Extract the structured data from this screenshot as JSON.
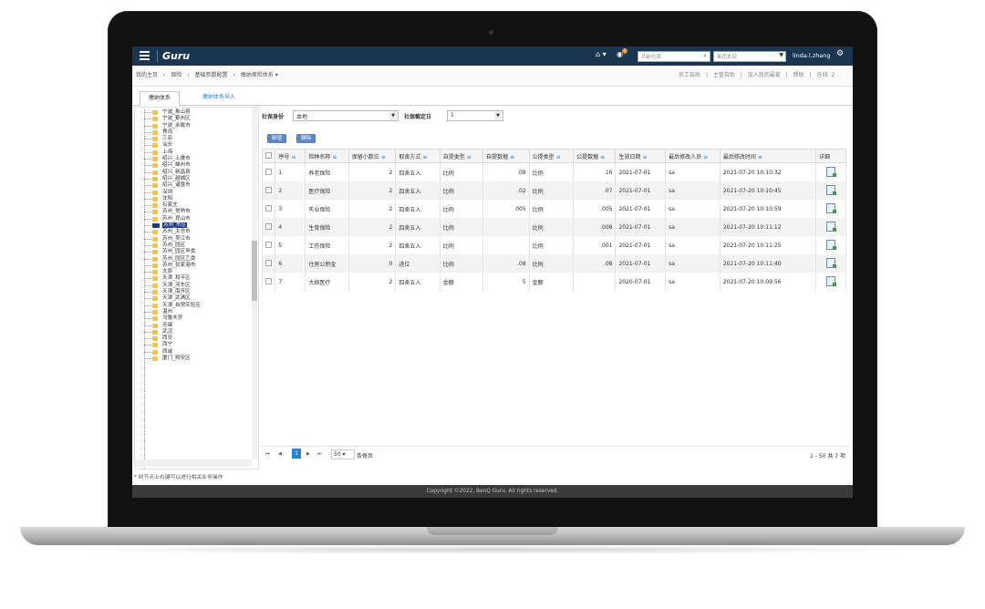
{
  "topbar": {
    "app_name": "Guru",
    "search_placeholder": "功能检索",
    "org_select_placeholder": "集团本部",
    "user_name": "linda.l.zhang",
    "notification_count": "2",
    "menu_icon": "hamburger-icon",
    "home_icon": "home-icon",
    "bell_icon": "bell-icon",
    "gear_icon": "gear-icon"
  },
  "breadcrumb": [
    "我的主页",
    "›",
    "保险",
    "›",
    "基础参数配置",
    "›",
    "缴纳保险体系 ▾"
  ],
  "toplinks": [
    "员工自助",
    "|",
    "主管自助",
    "|",
    "加入我的最爱",
    "|",
    "帮助",
    "|",
    "在线: 2"
  ],
  "tabs": [
    {
      "label": "缴纳体系",
      "active": true
    },
    {
      "label": "缴纳体系导入",
      "active": false
    }
  ],
  "tree": {
    "items": [
      "宁波_象山县",
      "宁波_鄞州区",
      "宁波_余姚市",
      "青岛",
      "三亚",
      "汕头",
      "上海",
      "绍兴_上虞市",
      "绍兴_嵊州市",
      "绍兴_新昌县",
      "绍兴_越城区",
      "绍兴_诸暨市",
      "深圳",
      "沈阳",
      "石家庄",
      "苏州_常熟市",
      "苏州_昆山市",
      "苏州_市区",
      "苏州_太仓市",
      "苏州_吴江市",
      "苏州_园区",
      "苏州_园区甲类",
      "苏州_园区乙类",
      "苏州_张家港市",
      "太原",
      "天津_和平区",
      "天津_河东区",
      "天津_南开区",
      "天津_武清区",
      "天津_自贸实验区",
      "温州",
      "乌鲁木齐",
      "无锡",
      "武汉",
      "西安",
      "西宁",
      "西咸",
      "厦门_翔安区"
    ],
    "selected": "苏州_市区",
    "note": "* 树节点上右键可以进行相关业务操作"
  },
  "filters": {
    "identity_label": "社保身份",
    "identity_value": "本地",
    "day_label": "社保截定日",
    "day_value": "1"
  },
  "buttons": {
    "add": "新增",
    "delete": "删除"
  },
  "table": {
    "columns": [
      "序号",
      "险种名称",
      "保留小数位",
      "取舍方式",
      "自提类型",
      "自提数据",
      "公提类型",
      "公提数据",
      "生效日期",
      "最后修改人员",
      "最后修改时间",
      "详细"
    ],
    "rows": [
      [
        "1",
        "养老保险",
        "2",
        "四舍五入",
        "比例",
        ".08",
        "比例",
        ".16",
        "2021-07-01",
        "sa",
        "2021-07-20 10:10:32"
      ],
      [
        "2",
        "医疗保险",
        "2",
        "四舍五入",
        "比例",
        ".02",
        "比例",
        ".07",
        "2021-07-01",
        "sa",
        "2021-07-20 10:10:45"
      ],
      [
        "3",
        "失业保险",
        "2",
        "四舍五入",
        "比例",
        ".005",
        "比例",
        ".005",
        "2021-07-01",
        "sa",
        "2021-07-20 10:10:59"
      ],
      [
        "4",
        "生育保险",
        "2",
        "四舍五入",
        "比例",
        "",
        "比例",
        ".008",
        "2021-07-01",
        "sa",
        "2021-07-20 10:11:12"
      ],
      [
        "5",
        "工伤保险",
        "2",
        "四舍五入",
        "比例",
        "",
        "比例",
        ".001",
        "2021-07-01",
        "sa",
        "2021-07-20 10:11:25"
      ],
      [
        "6",
        "住房公积金",
        "0",
        "进位",
        "比例",
        ".08",
        "比例",
        ".08",
        "2021-07-01",
        "sa",
        "2021-07-20 10:11:40"
      ],
      [
        "7",
        "大病医疗",
        "2",
        "四舍五入",
        "金额",
        "5",
        "金额",
        "",
        "2020-07-01",
        "sa",
        "2021-07-20 10:09:56"
      ]
    ]
  },
  "pager": {
    "current_page": "1",
    "page_size": "50",
    "per_page_label": "条每页",
    "summary": "1 - 50 共 7 项"
  },
  "footer": "Copyright ©2022, BenQ Guru. All rights reserved."
}
